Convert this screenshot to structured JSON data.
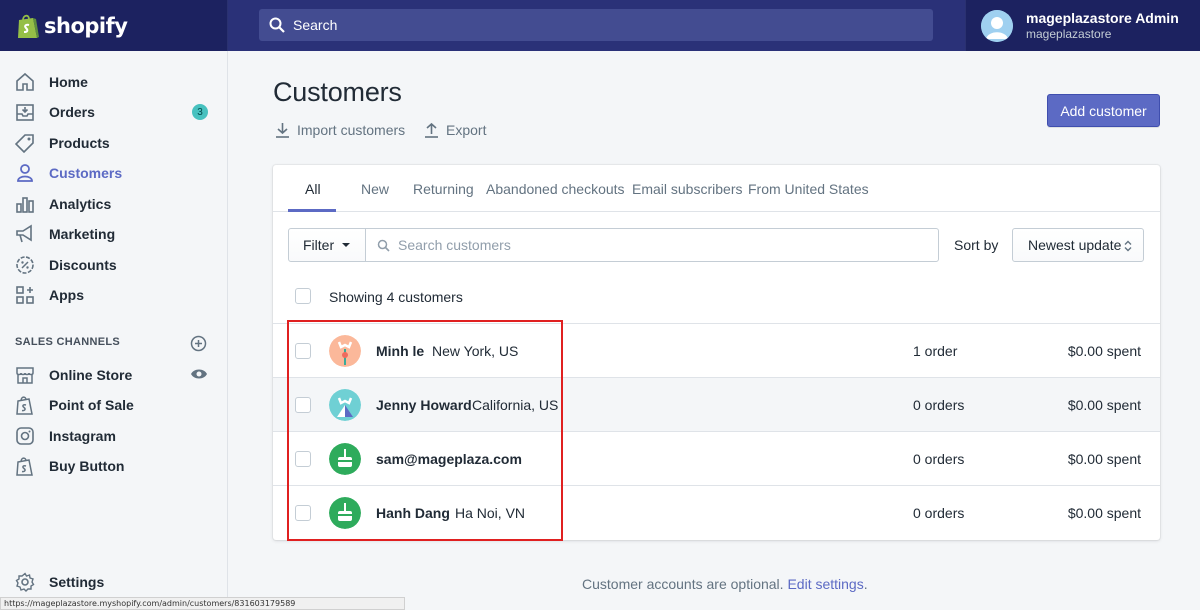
{
  "brand": {
    "name": "shopify"
  },
  "search": {
    "placeholder": "Search"
  },
  "account": {
    "name": "mageplazastore Admin",
    "store": "mageplazastore"
  },
  "sidebar": {
    "items": [
      {
        "label": "Home",
        "icon": "home-icon"
      },
      {
        "label": "Orders",
        "icon": "orders-icon",
        "badge": "3"
      },
      {
        "label": "Products",
        "icon": "tag-icon"
      },
      {
        "label": "Customers",
        "icon": "person-icon",
        "active": true
      },
      {
        "label": "Analytics",
        "icon": "bar-chart-icon"
      },
      {
        "label": "Marketing",
        "icon": "megaphone-icon"
      },
      {
        "label": "Discounts",
        "icon": "discount-icon"
      },
      {
        "label": "Apps",
        "icon": "apps-icon"
      }
    ],
    "sales_channels_label": "SALES CHANNELS",
    "channels": [
      {
        "label": "Online Store",
        "icon": "store-icon"
      },
      {
        "label": "Point of Sale",
        "icon": "shopify-bag-icon"
      },
      {
        "label": "Instagram",
        "icon": "instagram-icon"
      },
      {
        "label": "Buy Button",
        "icon": "shopify-bag-icon"
      }
    ],
    "settings_label": "Settings"
  },
  "page": {
    "title": "Customers",
    "import_label": "Import customers",
    "export_label": "Export",
    "add_button": "Add customer"
  },
  "tabs": [
    "All",
    "New",
    "Returning",
    "Abandoned checkouts",
    "Email subscribers",
    "From United States"
  ],
  "toolbar": {
    "filter_label": "Filter",
    "search_placeholder": "Search customers",
    "sort_label": "Sort by",
    "sort_value": "Newest update"
  },
  "list": {
    "showing": "Showing 4 customers",
    "customers": [
      {
        "name": "Minh le",
        "location": "New York, US",
        "orders": "1 order",
        "spent": "$0.00 spent",
        "avatar_color": "#fbb89a"
      },
      {
        "name": "Jenny Howard",
        "location": "California, US",
        "orders": "0 orders",
        "spent": "$0.00 spent",
        "avatar_color": "#6fd0d4"
      },
      {
        "name": "sam@mageplaza.com",
        "location": "",
        "orders": "0 orders",
        "spent": "$0.00 spent",
        "avatar_color": "#2eab5c"
      },
      {
        "name": "Hanh Dang",
        "location": "Ha Noi, VN",
        "orders": "0 orders",
        "spent": "$0.00 spent",
        "avatar_color": "#2eab5c"
      }
    ]
  },
  "footer": {
    "text": "Customer accounts are optional.",
    "link": "Edit settings",
    "suffix": "."
  },
  "statusbar": {
    "url": "https://mageplazastore.myshopify.com/admin/customers/831603179589"
  },
  "colors": {
    "topbar": "#1c2260",
    "accent": "#5c6ac4",
    "badge": "#47c1bf",
    "highlight": "#e02020"
  }
}
